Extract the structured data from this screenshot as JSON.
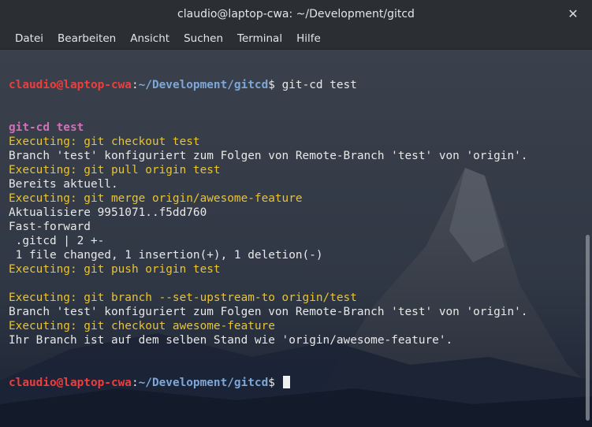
{
  "window": {
    "title": "claudio@laptop-cwa: ~/Development/gitcd",
    "close_icon": "close-icon"
  },
  "menu": {
    "items": [
      "Datei",
      "Bearbeiten",
      "Ansicht",
      "Suchen",
      "Terminal",
      "Hilfe"
    ]
  },
  "terminal": {
    "prompt_user": "claudio@laptop-cwa",
    "prompt_sep": ":",
    "prompt_path": "~/Development/gitcd",
    "prompt_dollar": "$",
    "command": " git-cd test",
    "lines": [
      {
        "cls": "magenta-bold",
        "text": "git-cd test"
      },
      {
        "cls": "yellow",
        "text": "Executing: git checkout test"
      },
      {
        "cls": "plain",
        "text": "Branch 'test' konfiguriert zum Folgen von Remote-Branch 'test' von 'origin'."
      },
      {
        "cls": "yellow",
        "text": "Executing: git pull origin test"
      },
      {
        "cls": "plain",
        "text": "Bereits aktuell."
      },
      {
        "cls": "yellow",
        "text": "Executing: git merge origin/awesome-feature"
      },
      {
        "cls": "plain",
        "text": "Aktualisiere 9951071..f5dd760"
      },
      {
        "cls": "plain",
        "text": "Fast-forward"
      },
      {
        "cls": "plain",
        "text": " .gitcd | 2 +-"
      },
      {
        "cls": "plain",
        "text": " 1 file changed, 1 insertion(+), 1 deletion(-)"
      },
      {
        "cls": "yellow",
        "text": "Executing: git push origin test"
      },
      {
        "cls": "plain",
        "text": ""
      },
      {
        "cls": "yellow",
        "text": "Executing: git branch --set-upstream-to origin/test"
      },
      {
        "cls": "plain",
        "text": "Branch 'test' konfiguriert zum Folgen von Remote-Branch 'test' von 'origin'."
      },
      {
        "cls": "yellow",
        "text": "Executing: git checkout awesome-feature"
      },
      {
        "cls": "plain",
        "text": "Ihr Branch ist auf dem selben Stand wie 'origin/awesome-feature'."
      }
    ]
  },
  "colors": {
    "user": "#ef3d3d",
    "path": "#7ea6d6",
    "yellow": "#e8c332",
    "magenta": "#d070b8"
  }
}
